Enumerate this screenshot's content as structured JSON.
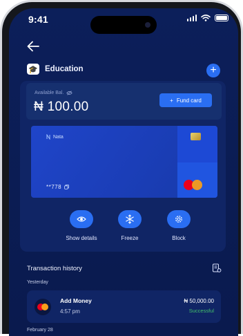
{
  "status_bar": {
    "time": "9:41"
  },
  "wallet": {
    "name": "Education",
    "icon": "mortarboard-icon"
  },
  "balance": {
    "label": "Available Bal.",
    "amount": "₦ 100.00"
  },
  "fund_button": {
    "label": "Fund card"
  },
  "card": {
    "brand": "Nata",
    "masked_number": "**778"
  },
  "actions": [
    {
      "label": "Show details",
      "icon": "eye-icon"
    },
    {
      "label": "Freeze",
      "icon": "snowflake-icon"
    },
    {
      "label": "Block",
      "icon": "gear-icon"
    }
  ],
  "transactions": {
    "title": "Transaction history",
    "groups": [
      {
        "label": "Yesterday",
        "items": [
          {
            "name": "Add Money",
            "time": "4:57 pm",
            "amount": "₦ 50,000.00",
            "status": "Successful"
          }
        ]
      },
      {
        "label": "February 28",
        "items": []
      }
    ]
  },
  "colors": {
    "accent": "#2a6ef2",
    "background": "#0c1f5a",
    "success": "#43c06b"
  }
}
